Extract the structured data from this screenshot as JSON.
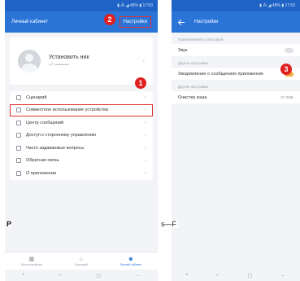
{
  "left": {
    "statusbar": "▮ ⁂ ◢ 48% ▮ 17:53",
    "header_title": "Личный кабинет",
    "header_action": "Настройки",
    "badge_settings": "2",
    "profile": {
      "name": "Установить ник",
      "phone": "+7 ••••••••••"
    },
    "badge_share": "1",
    "menu": [
      {
        "label": "Сценарий",
        "icon": "scenario-icon"
      },
      {
        "label": "Совместное использование устройства",
        "icon": "share-icon",
        "highlighted": true
      },
      {
        "label": "Центр сообщений",
        "icon": "message-icon"
      },
      {
        "label": "Доступ к стороннему управлению",
        "icon": "third-party-icon"
      },
      {
        "label": "Часто задаваемые вопросы",
        "icon": "faq-icon"
      },
      {
        "label": "Обратная связь",
        "icon": "feedback-icon"
      },
      {
        "label": "О приложении",
        "icon": "about-icon"
      }
    ],
    "bottom_nav": [
      {
        "label": "Мои устройства",
        "icon": "grid-icon",
        "glyph": "▦"
      },
      {
        "label": "Сценарий",
        "icon": "home-icon",
        "glyph": "⌂"
      },
      {
        "label": "Личный кабинет",
        "icon": "person-icon",
        "glyph": "☻",
        "active": true
      }
    ],
    "system_bar": [
      "•",
      "⌐",
      "▢",
      "←"
    ]
  },
  "right": {
    "statusbar": "▮ ⁂ ◢ 48% ▮ 17:53",
    "header_title": "Настройки",
    "section1_header": "Приложенный к голосовой",
    "row_sound": "Звук",
    "badge_toggle": "3",
    "section2_header": "Другие настройки",
    "row_notify": "Уведомление о сообщениях приложения",
    "section3_header": "Другие настройки",
    "row_cache": "Очистка кэша",
    "row_cache_value": "67,3МБ",
    "system_bar": [
      "•",
      "⌐",
      "▢",
      "←"
    ]
  },
  "caption_left": "P",
  "caption_right": "s—F",
  "colors": {
    "header_blue": "#2a74d8",
    "status_blue": "#1f63c6",
    "highlight_red": "#e03030",
    "badge_red": "#e02020",
    "toggle_orange": "#f2a93b"
  }
}
